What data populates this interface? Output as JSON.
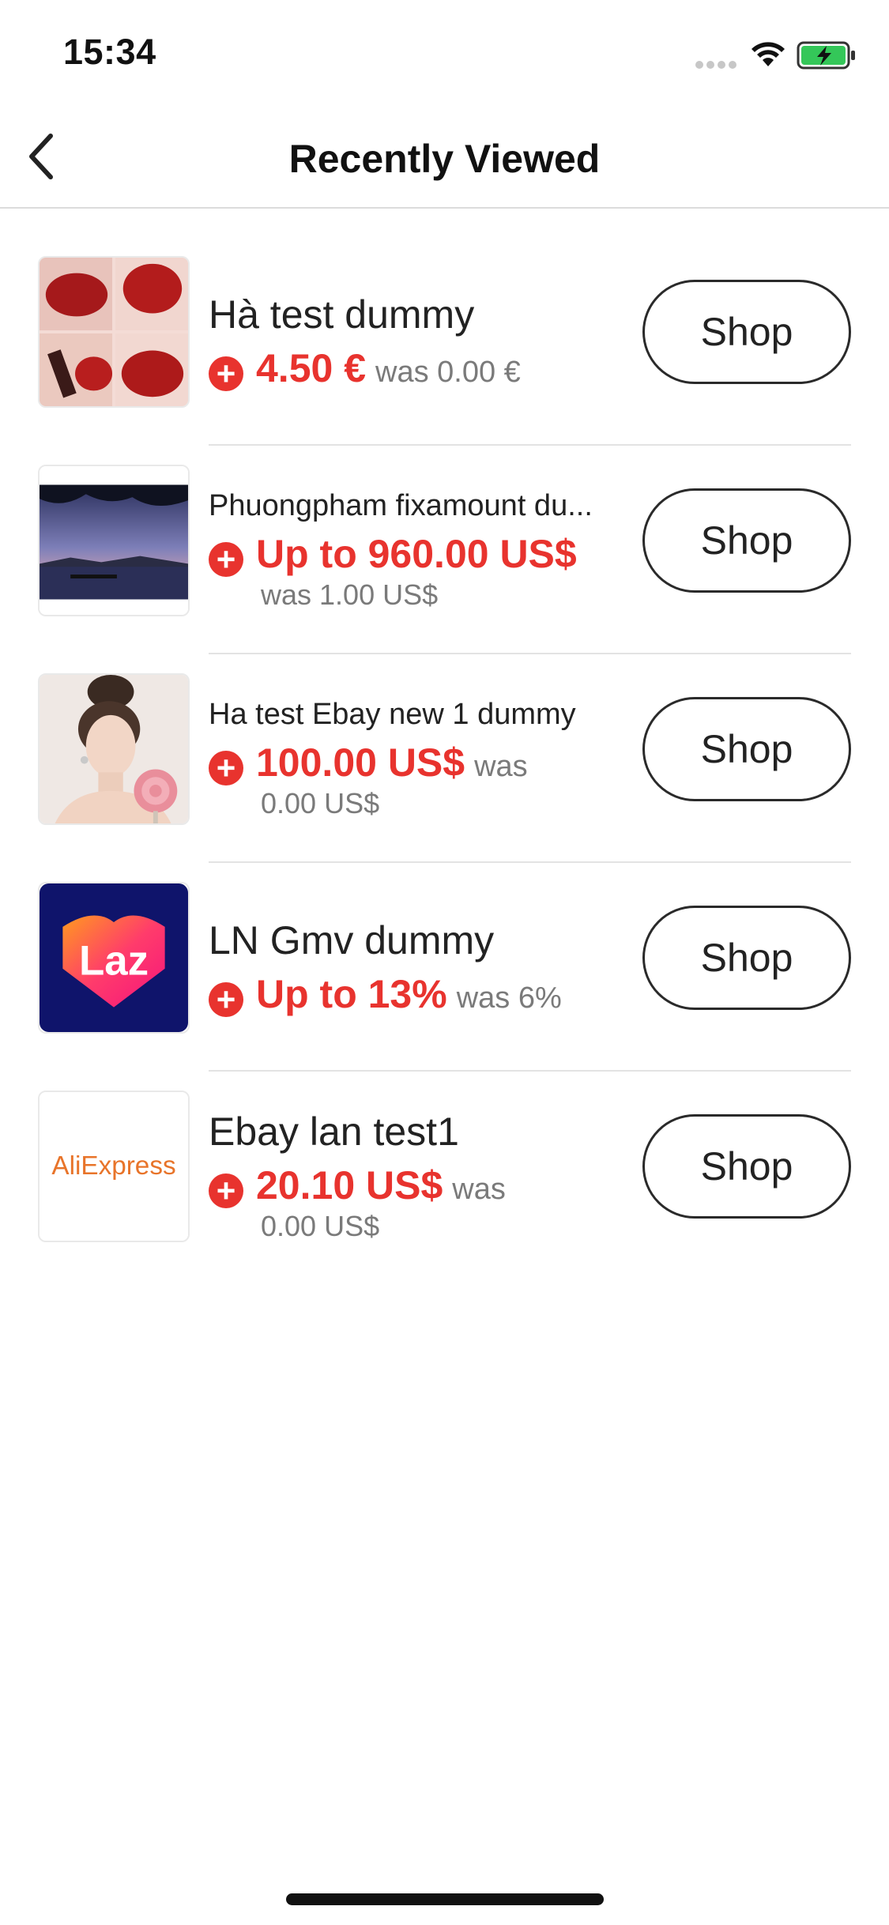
{
  "status_bar": {
    "time": "15:34"
  },
  "nav": {
    "title": "Recently Viewed"
  },
  "shop_label": "Shop",
  "items": [
    {
      "title": "Hà test dummy",
      "price": "4.50 €",
      "was": "was 0.00 €",
      "thumb": "lipstick-photo"
    },
    {
      "title": "Phuongpham fixamount du...",
      "price": "Up to 960.00 US$",
      "was": "was 1.00 US$",
      "thumb": "lake-sunset-photo"
    },
    {
      "title": "Ha test Ebay new 1 dummy",
      "price": "100.00 US$",
      "was_inline": "was",
      "was_rest": "0.00 US$",
      "thumb": "portrait-photo"
    },
    {
      "title": "LN Gmv dummy",
      "price": "Up to 13%",
      "was": "was 6%",
      "thumb": "lazada-logo",
      "logo_text": "Laz"
    },
    {
      "title": "Ebay lan test1",
      "price": "20.10 US$",
      "was_inline": "was",
      "was_rest": "0.00 US$",
      "thumb": "aliexpress-logo",
      "logo_text": "AliExpress"
    }
  ],
  "colors": {
    "accent": "#e8332e",
    "muted": "#7a7a7a",
    "divider": "#e3e3e3"
  }
}
